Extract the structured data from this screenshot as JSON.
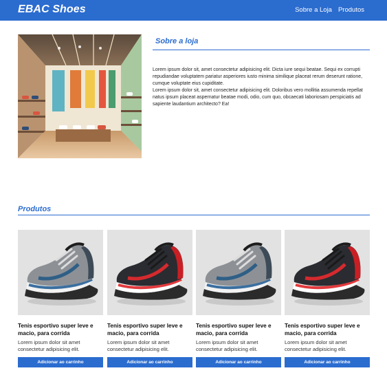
{
  "header": {
    "brand": "EBAC Shoes",
    "nav": [
      "Sobre a Loja",
      "Produtos"
    ]
  },
  "about": {
    "title": "Sobre a loja",
    "paragraphs": [
      "Lorem ipsum dolor sit, amet consectetur adipisicing elit. Dicta iure sequi beatae. Sequi ex corrupti repudiandae voluptatem pariatur asperiores iusto minima similique placeat rerum deserunt ratione, cumque voluptate eius cupiditate.",
      "Lorem ipsum dolor sit, amet consectetur adipisicing elit. Doloribus vero mollitia assumenda repellat natus ipsum placeat aspernatur beatae modi, odio, cum quo, obcaecati laboriosam perspiciatis ad sapiente laudantium architecto? Ea!"
    ]
  },
  "products_section": {
    "title": "Produtos",
    "items": [
      {
        "title": "Tenis esportivo super leve e macio, para corrida",
        "description": "Lorem ipsum dolor sit amet consectetur adipisicing elit.",
        "button": "Adicionar ao carrinho",
        "variant": "gray"
      },
      {
        "title": "Tenis esportivo super leve e macio, para corrida",
        "description": "Lorem ipsum dolor sit amet consectetur adipisicing elit.",
        "button": "Adicionar ao carrinho",
        "variant": "red"
      },
      {
        "title": "Tenis esportivo super leve e macio, para corrida",
        "description": "Lorem ipsum dolor sit amet consectetur adipisicing elit.",
        "button": "Adicionar ao carrinho",
        "variant": "gray"
      },
      {
        "title": "Tenis esportivo super leve e macio, para corrida",
        "description": "Lorem ipsum dolor sit amet consectetur adipisicing elit.",
        "button": "Adicionar ao carrinho",
        "variant": "red"
      }
    ]
  },
  "colors": {
    "primary": "#2b6ccf"
  }
}
